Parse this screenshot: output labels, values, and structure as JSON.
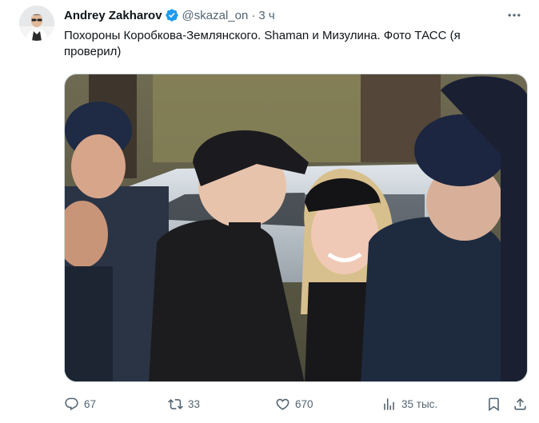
{
  "author": {
    "name": "Andrey Zakharov",
    "handle": "@skazal_on",
    "separator": "·",
    "time": "3 ч"
  },
  "tweet": {
    "text": "Похороны Коробкова-Землянского. Shaman и Мизулина. Фото ТАСС (я проверил)"
  },
  "actions": {
    "replies": "67",
    "retweets": "33",
    "likes": "670",
    "views": "35 тыс."
  },
  "colors": {
    "text": "#0f1419",
    "muted": "#536471",
    "verified": "#1d9bf0"
  }
}
